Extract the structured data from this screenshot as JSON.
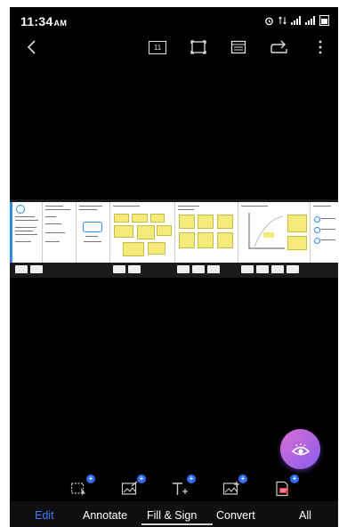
{
  "status_bar": {
    "time": "11:34",
    "ampm": "AM"
  },
  "toolbar": {
    "page_count": "11",
    "back_icon": "back-arrow-icon",
    "crop_icon": "crop-icon",
    "layout_icon": "page-layout-icon",
    "share_icon": "share-icon",
    "more_icon": "more-vertical-icon"
  },
  "tools": [
    "select-edit-icon",
    "edit-image-icon",
    "add-text-icon",
    "add-image-icon",
    "edit-pdf-icon"
  ],
  "tabs": [
    {
      "label": "Edit",
      "active": true
    },
    {
      "label": "Annotate",
      "active": false
    },
    {
      "label": "Fill & Sign",
      "active": false
    },
    {
      "label": "Convert",
      "active": false
    },
    {
      "label": "All",
      "active": false
    }
  ],
  "colors": {
    "background": "#000000",
    "accent": "#3d7bf5",
    "fab_start": "#d96ed0",
    "fab_end": "#8a5cf0",
    "highlight": "#f4ea7a"
  }
}
